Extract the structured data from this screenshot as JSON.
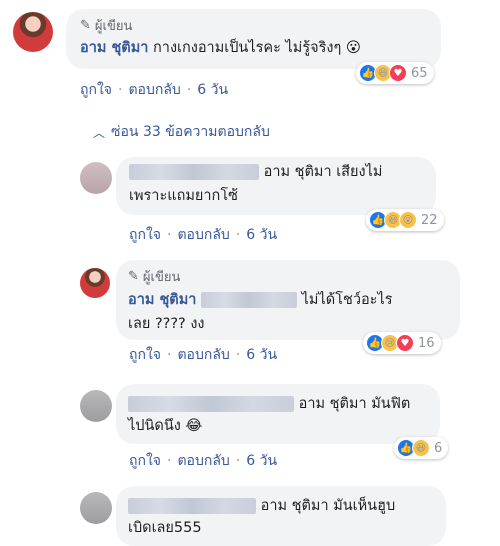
{
  "top_comment": {
    "author_tag": "ผู้เขียน",
    "name": "อาม ชุติมา",
    "text": "กางเกงอามเป็นไรคะ ไม่รู้จริงๆ 😮",
    "like_label": "ถูกใจ",
    "reply_label": "ตอบกลับ",
    "time": "6 วัน",
    "reaction_count": "65"
  },
  "hide_replies": "ซ่อน 33 ข้อความตอบกลับ",
  "replies": [
    {
      "text_line1": "อาม ชุติมา เสียงไม่",
      "text_line2": "เพราะแถมยากโซ้",
      "like_label": "ถูกใจ",
      "reply_label": "ตอบกลับ",
      "time": "6 วัน",
      "reaction_count": "22"
    },
    {
      "author_tag": "ผู้เขียน",
      "name": "อาม ชุติมา",
      "text_line1": "ไม่ได้โชว์อะไร",
      "text_line2": "เลย ???? งง",
      "like_label": "ถูกใจ",
      "reply_label": "ตอบกลับ",
      "time": "6 วัน",
      "reaction_count": "16"
    },
    {
      "text_line1": "อาม ชุติมา มันฟิต",
      "text_line2": "ไปนิดนึง 😂",
      "like_label": "ถูกใจ",
      "reply_label": "ตอบกลับ",
      "time": "6 วัน",
      "reaction_count": "6"
    },
    {
      "text_line1": "อาม ชุติมา มันเห็นฮูบ",
      "text_line2": "เบิดเลย555"
    }
  ],
  "colors": {
    "link": "#385898",
    "bubble": "#f2f3f5",
    "meta": "#90949c"
  }
}
